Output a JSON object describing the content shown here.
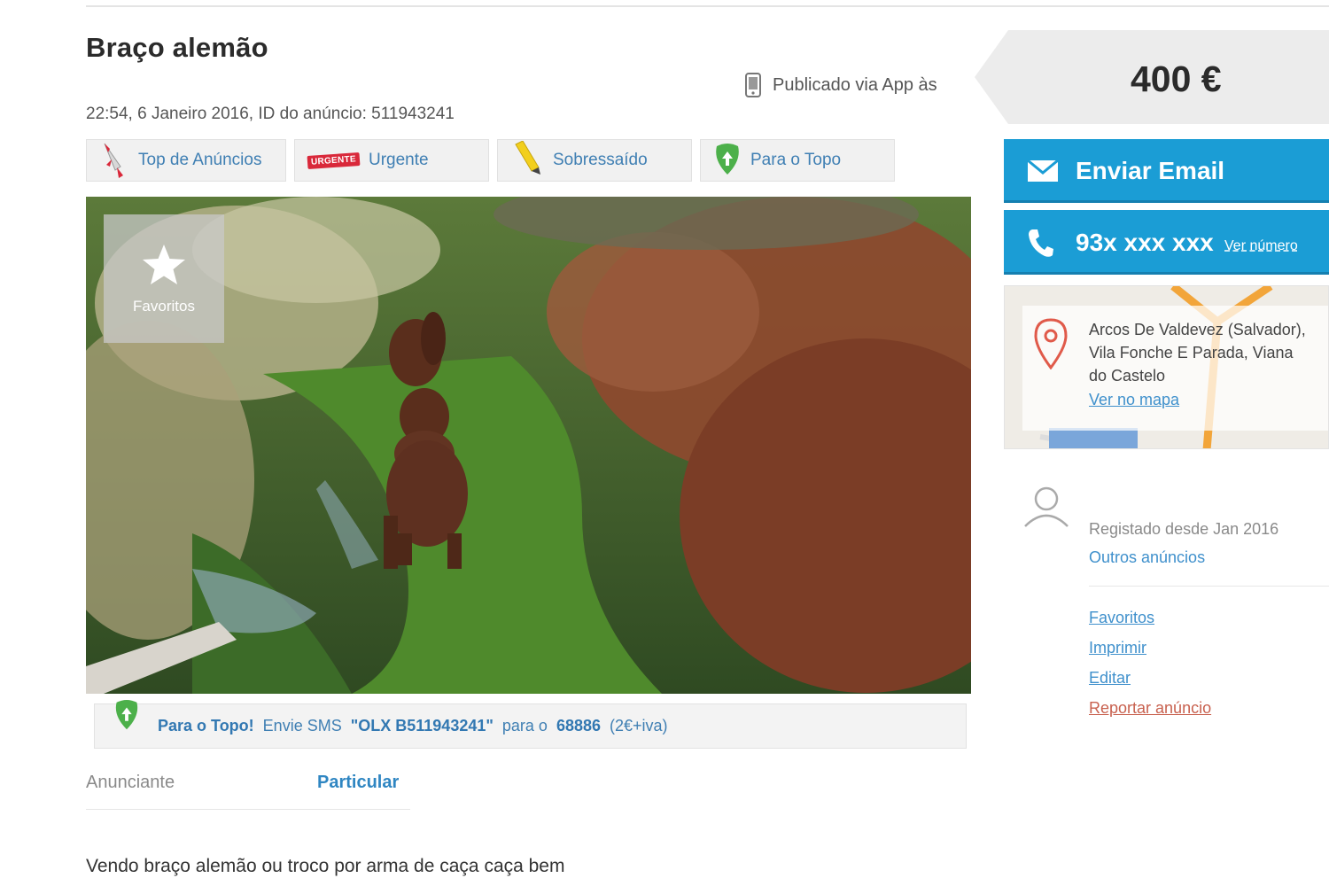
{
  "listing": {
    "title": "Braço alemão",
    "published_via": "Publicado via App às",
    "meta": "22:54, 6 Janeiro 2016, ID do anúncio: 511943241",
    "price": "400 €",
    "description": "Vendo braço alemão ou troco por arma de caça caça bem"
  },
  "promo": {
    "buttons": [
      {
        "label": "Top de Anúncios",
        "icon": "rocket-icon"
      },
      {
        "label": "Urgente",
        "icon": "urgent-tag-icon",
        "tag": "URGENTE"
      },
      {
        "label": "Sobressaído",
        "icon": "highlighter-icon"
      },
      {
        "label": "Para o Topo",
        "icon": "up-arrow-leaf-icon"
      }
    ]
  },
  "photo": {
    "favorites_label": "Favoritos"
  },
  "sms": {
    "lead": "Para o Topo!",
    "text1": "Envie SMS",
    "code": "\"OLX B511943241\"",
    "text2": "para o",
    "number": "68886",
    "cost": "(2€+iva)"
  },
  "advertiser": {
    "label": "Anunciante",
    "value": "Particular"
  },
  "contact": {
    "email_label": "Enviar Email",
    "phone_masked": "93x xxx xxx",
    "phone_reveal": "Ver número"
  },
  "location": {
    "line1": "Arcos De Valdevez (Salvador),",
    "line2": "Vila Fonche E Parada, Viana",
    "line3": "do Castelo",
    "map_link": "Ver no mapa"
  },
  "seller": {
    "registered": "Registado desde Jan 2016",
    "other_ads": "Outros anúncios"
  },
  "side_links": {
    "favorites": "Favoritos",
    "print": "Imprimir",
    "edit": "Editar",
    "report": "Reportar anúncio"
  },
  "colors": {
    "primary_button": "#1b9dd5",
    "link": "#3f90cc",
    "report_link": "#c8614f",
    "price_box": "#ececec"
  }
}
